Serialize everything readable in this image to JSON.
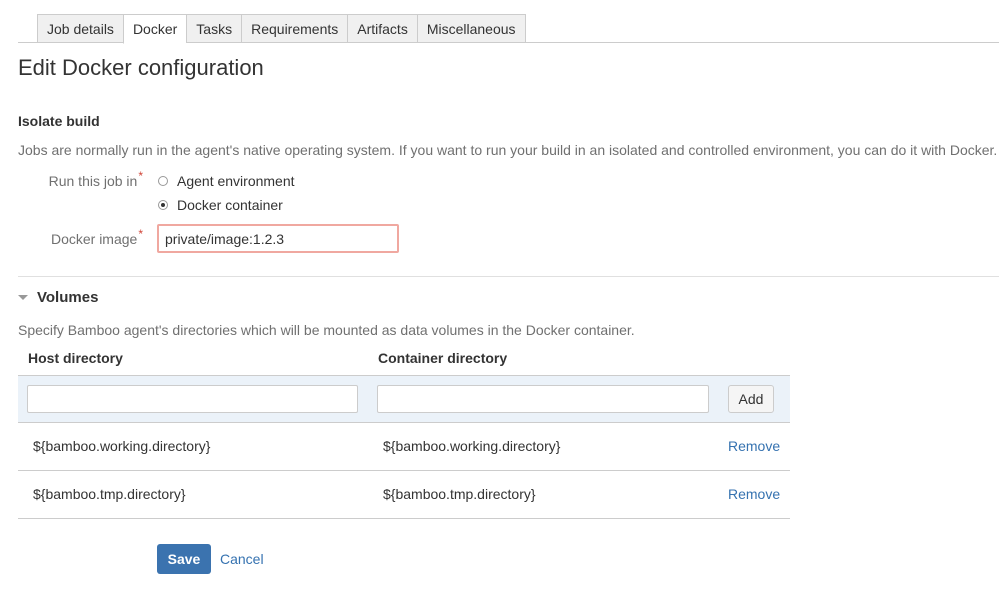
{
  "tabs": [
    {
      "label": "Job details",
      "active": false
    },
    {
      "label": "Docker",
      "active": true
    },
    {
      "label": "Tasks",
      "active": false
    },
    {
      "label": "Requirements",
      "active": false
    },
    {
      "label": "Artifacts",
      "active": false
    },
    {
      "label": "Miscellaneous",
      "active": false
    }
  ],
  "page_title": "Edit Docker configuration",
  "isolate": {
    "title": "Isolate build",
    "description": "Jobs are normally run in the agent's native operating system. If you want to run your build in an isolated and controlled environment, you can do it with Docker.",
    "run_label": "Run this job in",
    "required_mark": "*",
    "options": [
      {
        "label": "Agent environment",
        "checked": false
      },
      {
        "label": "Docker container",
        "checked": true
      }
    ],
    "image_label": "Docker image",
    "image_value": "private/image:1.2.3"
  },
  "volumes": {
    "title": "Volumes",
    "description": "Specify Bamboo agent's directories which will be mounted as data volumes in the Docker container.",
    "col_host": "Host directory",
    "col_container": "Container directory",
    "host_input_value": "",
    "container_input_value": "",
    "add_label": "Add",
    "rows": [
      {
        "host": "${bamboo.working.directory}",
        "container": "${bamboo.working.directory}",
        "action": "Remove"
      },
      {
        "host": "${bamboo.tmp.directory}",
        "container": "${bamboo.tmp.directory}",
        "action": "Remove"
      }
    ]
  },
  "actions": {
    "save_label": "Save",
    "cancel_label": "Cancel"
  },
  "colors": {
    "primary": "#3b73af",
    "link": "#3572b0",
    "required": "#d04437",
    "add_row_bg": "#ebf2f9"
  }
}
